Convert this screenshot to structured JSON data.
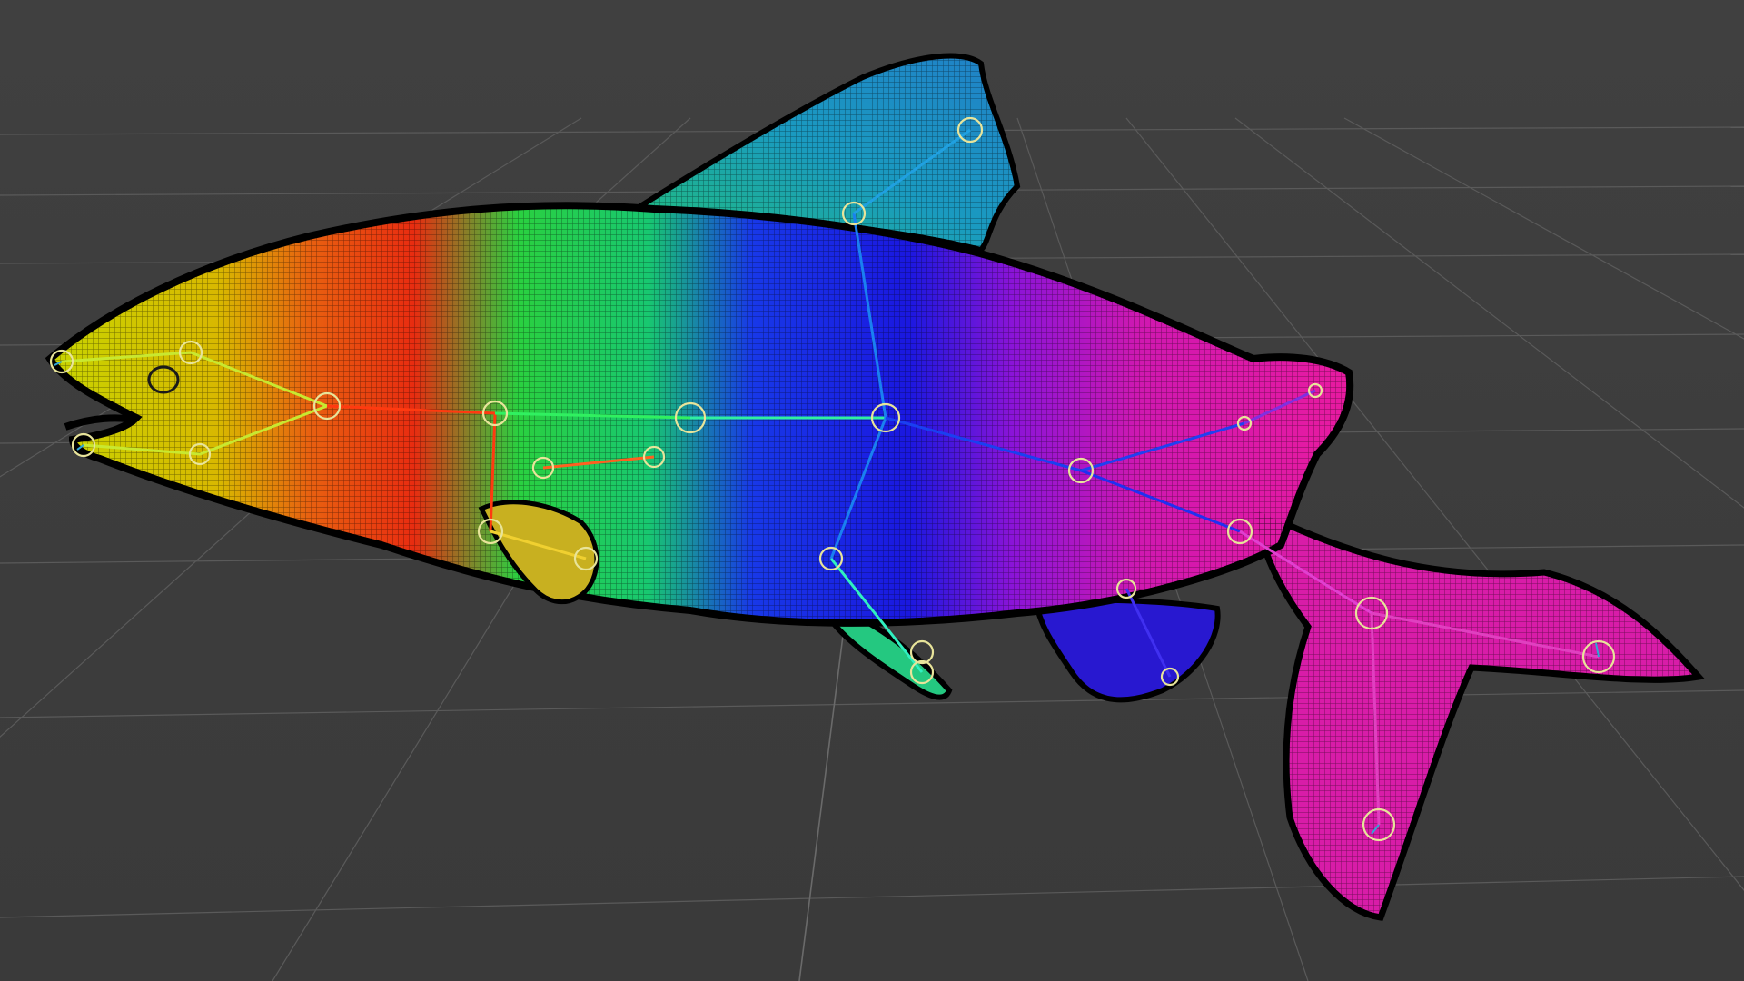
{
  "viewport": {
    "label": "",
    "background_color": "#3f3f3f",
    "grid_color": "#5a5a5a"
  },
  "model": {
    "name": "",
    "description_colors": {
      "head": "#c8d400",
      "gill": "#e83a10",
      "front_body": "#20d050",
      "mid_body": "#1a2ae8",
      "rear_body": "#9a14d8",
      "tail": "#e01aa8",
      "dorsal_fin": "#1e90c8",
      "joint_marker": "#e8e49a"
    }
  }
}
